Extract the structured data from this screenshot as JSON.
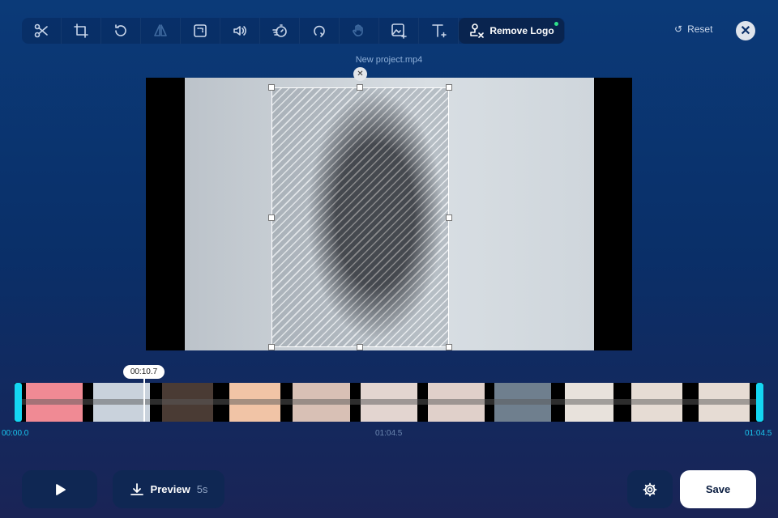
{
  "toolbar": {
    "tools": [
      "cut",
      "crop",
      "rotate",
      "flip",
      "resize",
      "volume",
      "speed",
      "loop",
      "stabilize",
      "add-image",
      "add-text"
    ],
    "active_label": "Remove Logo"
  },
  "header": {
    "reset_label": "Reset",
    "close_label": "✕"
  },
  "video": {
    "filename": "New project.mp4",
    "selection_close": "✕"
  },
  "timeline": {
    "cursor_time": "00:10.7",
    "start": "00:00.0",
    "middle": "01:04.5",
    "end": "01:04.5",
    "cursor_fraction": 0.166
  },
  "bottom": {
    "preview_label": "Preview",
    "preview_duration": "5s",
    "save_label": "Save"
  },
  "colors": {
    "accent": "#14d6f2",
    "active_dot": "#2ee08a"
  }
}
